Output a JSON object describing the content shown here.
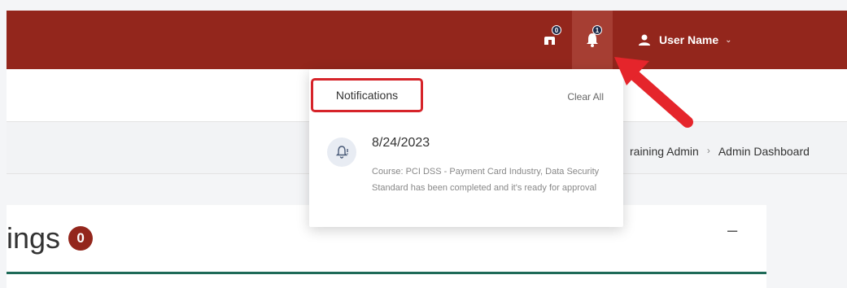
{
  "topbar": {
    "messages_badge": "0",
    "notifications_badge": "1",
    "user_name": "User Name"
  },
  "breadcrumb": [
    "raining Admin",
    "Admin Dashboard"
  ],
  "notifications": {
    "title": "Notifications",
    "clear_all": "Clear All",
    "items": [
      {
        "date": "8/24/2023",
        "text": "Course: PCI DSS - Payment Card Industry, Data Security Standard has been completed and it's ready for approval"
      }
    ]
  },
  "card": {
    "title": "ings",
    "count": "0",
    "collapse": "–"
  },
  "colors": {
    "brand": "#93261c",
    "badge": "#1d2a4a",
    "highlight": "#d6242a",
    "accent_rule": "#1e6a58"
  }
}
